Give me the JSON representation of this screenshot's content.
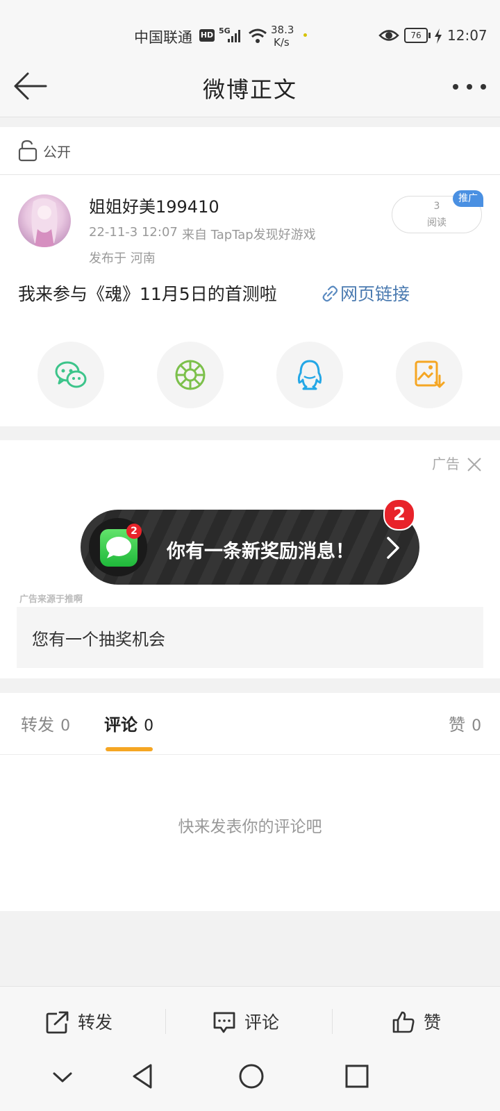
{
  "status_bar": {
    "carrier": "中国联通",
    "hd": "HD",
    "network": "5G",
    "speed_value": "38.3",
    "speed_unit": "K/s",
    "battery": "76",
    "time": "12:07"
  },
  "header": {
    "title": "微博正文"
  },
  "visibility": {
    "label": "公开"
  },
  "post": {
    "author": "姐姐好美199410",
    "meta_time": "22-11-3 12:07",
    "meta_source": "来自 TapTap发现好游戏",
    "location": "发布于 河南",
    "reads_count": "3",
    "reads_label": "阅读",
    "promote_badge": "推广",
    "text": "我来参与《魂》11月5日的首测啦",
    "link_label": "网页链接"
  },
  "share_buttons": [
    {
      "name": "wechat",
      "icon": "wechat-icon",
      "color": "#3cc48a"
    },
    {
      "name": "moments",
      "icon": "moments-icon",
      "color": "#7cc04b"
    },
    {
      "name": "qq",
      "icon": "qq-icon",
      "color": "#23a7e6"
    },
    {
      "name": "save-image",
      "icon": "image-download-icon",
      "color": "#f5a623"
    }
  ],
  "ad": {
    "ad_label": "广告",
    "banner_text": "你有一条新奖励消息！",
    "badge_count": "2",
    "app_badge": "2",
    "source": "广告来源于推啊",
    "lottery_text": "您有一个抽奖机会"
  },
  "tabs": {
    "repost_label": "转发",
    "repost_count": "0",
    "comment_label": "评论",
    "comment_count": "0",
    "like_label": "赞",
    "like_count": "0",
    "active": "comment",
    "accent_color": "#f5a623"
  },
  "comments": {
    "empty_text": "快来发表你的评论吧"
  },
  "actions": {
    "repost": "转发",
    "comment": "评论",
    "like": "赞"
  }
}
